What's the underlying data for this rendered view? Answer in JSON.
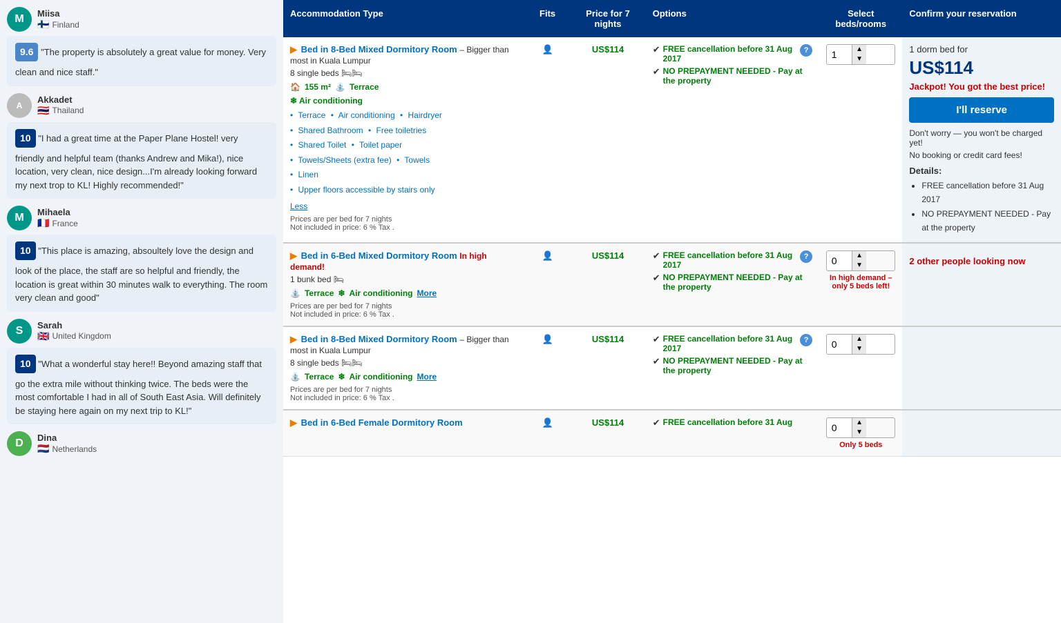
{
  "sidebar": {
    "reviewers": [
      {
        "name": "Miisa",
        "country": "Finland",
        "flag": "🇫🇮",
        "avatarLetter": "M",
        "avatarColor": "teal",
        "score": "9.6",
        "scoreColor": "light",
        "review": "\"The property is absolutely a great value for money. Very clean and nice staff.\""
      },
      {
        "name": "Akkadet",
        "country": "Thailand",
        "flag": "🇹🇭",
        "avatarType": "image",
        "score": "10",
        "scoreColor": "dark",
        "review": "\"I had a great time at the Paper Plane Hostel! very friendly and helpful team (thanks Andrew and Mika!), nice location, very clean, nice design...I'm already looking forward my next trop to KL! Highly recommended!\""
      },
      {
        "name": "Mihaela",
        "country": "France",
        "flag": "🇫🇷",
        "avatarLetter": "M",
        "avatarColor": "teal",
        "score": "10",
        "scoreColor": "dark",
        "review": "\"This place is amazing, absoultely love the design and look of the place, the staff are so helpful and friendly, the location is great within 30 minutes walk to everything. The room very clean and good\""
      },
      {
        "name": "Sarah",
        "country": "United Kingdom",
        "flag": "🇬🇧",
        "avatarLetter": "S",
        "avatarColor": "teal",
        "score": "10",
        "scoreColor": "dark",
        "review": "\"What a wonderful stay here!! Beyond amazing staff that go the extra mile without thinking twice. The beds were the most comfortable I had in all of South East Asia. Will definitely be staying here again on my next trip to KL!\""
      },
      {
        "name": "Dina",
        "country": "Netherlands",
        "flag": "🇳🇱",
        "avatarLetter": "D",
        "avatarColor": "green"
      }
    ]
  },
  "table": {
    "headers": {
      "type": "Accommodation Type",
      "fits": "Fits",
      "price": "Price for 7 nights",
      "options": "Options",
      "select": "Select beds/rooms",
      "confirm": "Confirm your reservation"
    },
    "rows": [
      {
        "id": "row1",
        "title": "Bed in 8-Bed Mixed Dormitory Room",
        "desc": "– Bigger than most in Kuala Lumpur",
        "inDemand": false,
        "beds": "8 single beds 🛏🛏",
        "size": "155 m²",
        "terrace": "Terrace",
        "aircon": "Air conditioning",
        "amenities": [
          "Terrace",
          "Air conditioning",
          "Hairdryer",
          "Shared Bathroom",
          "Free toiletries",
          "Shared Toilet",
          "Toilet paper",
          "Towels/Sheets (extra fee)",
          "Towels",
          "Linen",
          "Upper floors accessible by stairs only"
        ],
        "showLess": true,
        "showMore": false,
        "priceNote": "Prices are per bed for 7 nights",
        "taxNote": "Not included in price: 6 % Tax .",
        "price": "US$114",
        "fits": "👤",
        "options": [
          "FREE cancellation before 31 Aug 2017",
          "NO PREPAYMENT NEEDED - Pay at the property"
        ],
        "selectQty": "1",
        "confirmSection": {
          "show": true,
          "dormText": "1 dorm bed for",
          "price": "US$114",
          "jackpot": "Jackpot! You got the best price!",
          "btnLabel": "I'll reserve",
          "noCharge": "Don't worry — you won't be charged yet!",
          "noFee": "No booking or credit card fees!",
          "detailsLabel": "Details:",
          "detailsList": [
            "FREE cancellation before 31 Aug 2017",
            "NO PREPAYMENT NEEDED - Pay at the property"
          ]
        }
      },
      {
        "id": "row2",
        "title": "Bed in 6-Bed Mixed Dormitory Room",
        "desc": "",
        "inDemand": true,
        "inDemandText": "In high demand!",
        "beds": "1 bunk bed 🛏",
        "size": null,
        "terrace": "Terrace",
        "aircon": "Air conditioning",
        "amenities": [],
        "showLess": false,
        "showMore": true,
        "priceNote": "Prices are per bed for 7 nights",
        "taxNote": "Not included in price: 6 % Tax .",
        "price": "US$114",
        "fits": "👤",
        "options": [
          "FREE cancellation before 31 Aug 2017",
          "NO PREPAYMENT NEEDED - Pay at the property"
        ],
        "selectQty": "0",
        "demandNote": "In high demand – only 5 beds left!",
        "confirmSection": {
          "show": false,
          "lookingNow": "2 other people looking now"
        }
      },
      {
        "id": "row3",
        "title": "Bed in 8-Bed Mixed Dormitory Room",
        "desc": "– Bigger than most in Kuala Lumpur",
        "inDemand": false,
        "beds": "8 single beds 🛏🛏",
        "size": null,
        "terrace": "Terrace",
        "aircon": "Air conditioning",
        "amenities": [],
        "showLess": false,
        "showMore": true,
        "priceNote": "Prices are per bed for 7 nights",
        "taxNote": "Not included in price: 6 % Tax .",
        "price": "US$114",
        "fits": "👤",
        "options": [
          "FREE cancellation before 31 Aug 2017",
          "NO PREPAYMENT NEEDED - Pay at the property"
        ],
        "selectQty": "0",
        "confirmSection": {
          "show": false
        }
      },
      {
        "id": "row4",
        "title": "Bed in 6-Bed Female Dormitory Room",
        "desc": "",
        "inDemand": false,
        "beds": "",
        "size": null,
        "terrace": null,
        "aircon": null,
        "amenities": [],
        "showLess": false,
        "showMore": false,
        "priceNote": "",
        "taxNote": "",
        "price": "US$114",
        "fits": "👤",
        "options": [
          "FREE cancellation before 31 Aug"
        ],
        "selectQty": "0",
        "demandNote": "Only 5 beds",
        "confirmSection": {
          "show": false
        }
      }
    ]
  }
}
